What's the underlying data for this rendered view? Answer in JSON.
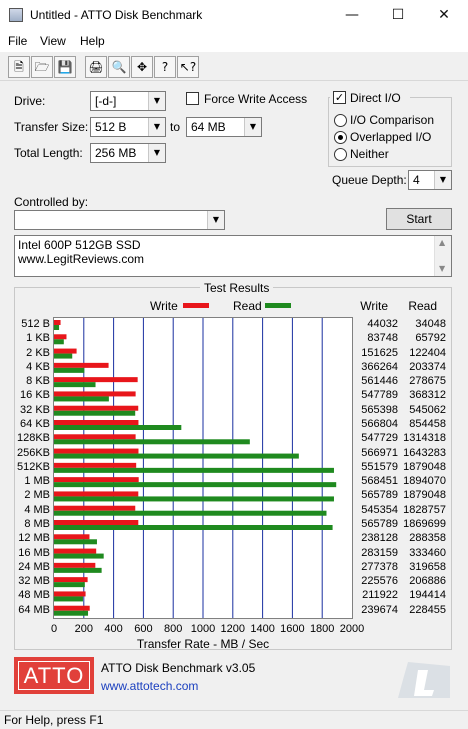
{
  "window": {
    "title": "Untitled - ATTO Disk Benchmark"
  },
  "menu": [
    "File",
    "View",
    "Help"
  ],
  "toolbar": {
    "icons": [
      "new-file-icon",
      "open-folder-icon",
      "save-icon",
      "print-icon",
      "print-preview-icon",
      "move-icon",
      "help-icon",
      "context-help-icon"
    ]
  },
  "settings": {
    "drive_label": "Drive:",
    "drive_value": "[-d-]",
    "transfer_size_label": "Transfer Size:",
    "transfer_from": "512 B",
    "to_label": "to",
    "transfer_to": "64 MB",
    "total_length_label": "Total Length:",
    "total_length_value": "256 MB",
    "force_write_label": "Force Write Access",
    "force_write_checked": false,
    "direct_io_label": "Direct I/O",
    "direct_io_checked": true,
    "io_comparison_label": "I/O Comparison",
    "overlapped_io_label": "Overlapped I/O",
    "neither_label": "Neither",
    "selected_io_mode": "Overlapped I/O",
    "queue_depth_label": "Queue Depth:",
    "queue_depth_value": "4",
    "controlled_by_label": "Controlled by:",
    "controlled_by_value": "",
    "start_label": "Start"
  },
  "description": {
    "line1": "Intel 600P 512GB SSD",
    "line2": "www.LegitReviews.com"
  },
  "results": {
    "title": "Test Results",
    "legend_write": "Write",
    "legend_read": "Read",
    "col_write": "Write",
    "col_read": "Read",
    "xlabel": "Transfer Rate - MB / Sec",
    "xticks": [
      "0",
      "200",
      "400",
      "600",
      "800",
      "1000",
      "1200",
      "1400",
      "1600",
      "1800",
      "2000"
    ]
  },
  "colors": {
    "write": "#e8161b",
    "read": "#1f8a1f",
    "grid": "#1a2fa0",
    "logo": "#e1403a"
  },
  "chart_data": {
    "type": "bar",
    "orientation": "horizontal",
    "categories": [
      "512 B",
      "1 KB",
      "2 KB",
      "4 KB",
      "8 KB",
      "16 KB",
      "32 KB",
      "64 KB",
      "128KB",
      "256KB",
      "512KB",
      "1 MB",
      "2 MB",
      "4 MB",
      "8 MB",
      "12 MB",
      "16 MB",
      "24 MB",
      "32 MB",
      "48 MB",
      "64 MB"
    ],
    "series": [
      {
        "name": "Write",
        "values": [
          44032,
          83748,
          151625,
          366264,
          561446,
          547789,
          565398,
          566804,
          547729,
          566971,
          551579,
          568451,
          565789,
          545354,
          565789,
          238128,
          283159,
          277378,
          225576,
          211922,
          239674
        ]
      },
      {
        "name": "Read",
        "values": [
          34048,
          65792,
          122404,
          203374,
          278675,
          368312,
          545062,
          854458,
          1314318,
          1643283,
          1879048,
          1894070,
          1879048,
          1828757,
          1869699,
          288358,
          333460,
          319658,
          206886,
          194414,
          228455
        ]
      }
    ],
    "xlim": [
      0,
      2000
    ],
    "xlabel": "Transfer Rate - MB / Sec",
    "grid": true,
    "legend": "top"
  },
  "footer": {
    "version": "ATTO Disk Benchmark v3.05",
    "link": "www.attotech.com",
    "logo_text": "ATTO"
  },
  "status": "For Help, press F1"
}
